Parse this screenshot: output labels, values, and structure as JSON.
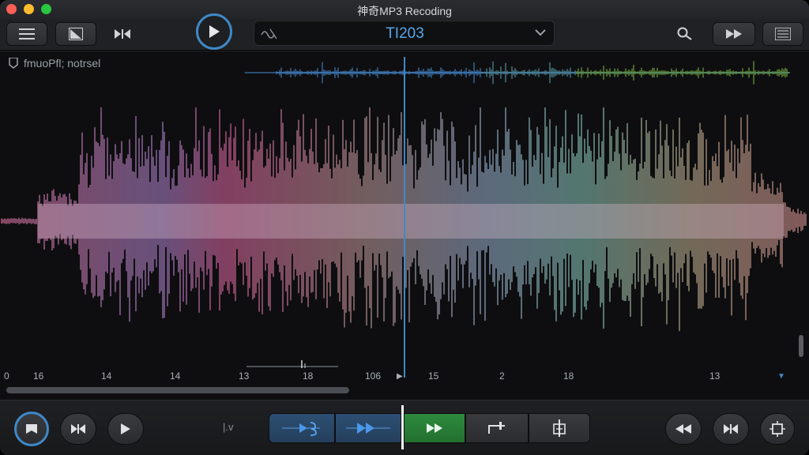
{
  "window": {
    "title": "神奇MP3 Recoding"
  },
  "toolbar": {
    "track_display": "TI203",
    "buttons": [
      {
        "name": "menu-button",
        "icon": "hamburger-icon"
      },
      {
        "name": "crop-button",
        "icon": "crop-icon"
      },
      {
        "name": "skip-button",
        "icon": "skip-icon"
      },
      {
        "name": "search-button",
        "icon": "search-icon"
      },
      {
        "name": "fast-forward-button",
        "icon": "fast-forward-icon"
      },
      {
        "name": "list-button",
        "icon": "list-icon"
      }
    ]
  },
  "waveform": {
    "label": "fmuoPfl; notrsel",
    "ruler_ticks": [
      "0",
      "16",
      "14",
      "14",
      "13",
      "18",
      "106",
      "15",
      "2",
      "18",
      "13"
    ],
    "colors": {
      "playhead": "#3f88c7",
      "overview_blue": "#4a90d9",
      "overview_green": "#7fbf3f"
    }
  },
  "transport": {
    "small_label": "|.v",
    "colors": {
      "accent_blue": "#3f88c7",
      "active_green": "#2d8a3e"
    }
  }
}
